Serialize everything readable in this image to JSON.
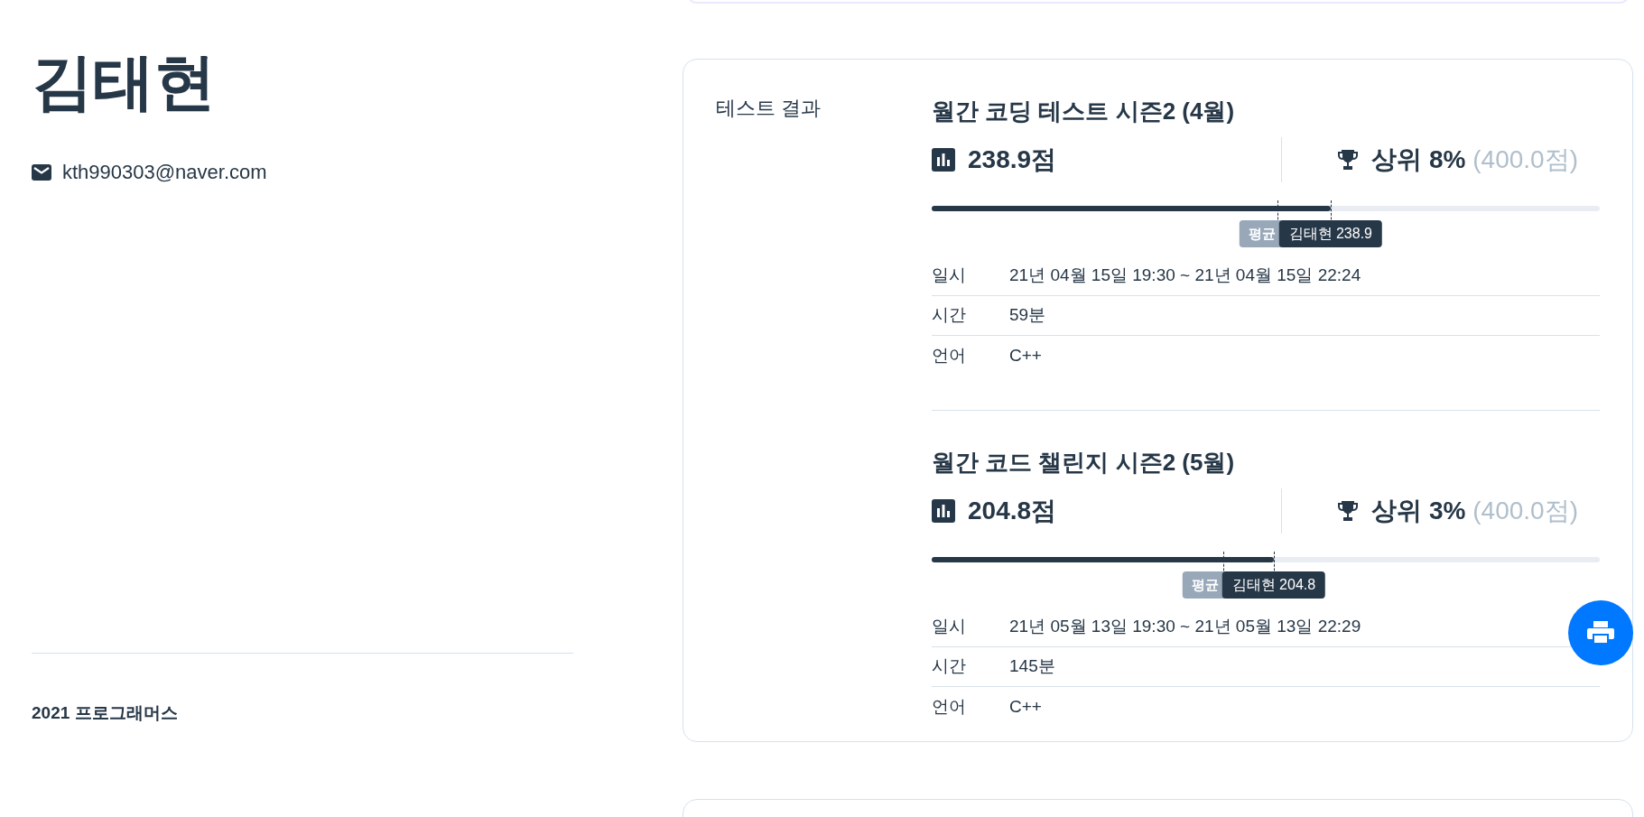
{
  "profile": {
    "name": "김태현",
    "email": "kth990303@naver.com"
  },
  "footer": {
    "copyright": "2021 프로그래머스"
  },
  "test_results": {
    "heading": "테스트 결과",
    "tests": [
      {
        "title": "월간 코딩 테스트 시즌2 (4월)",
        "score": "238.9점",
        "rank": "상위 8%",
        "max_score": "(400.0점)",
        "level": 0.597,
        "average": {
          "label": "평균",
          "level": 0.518
        },
        "user_marker": {
          "label": "김태현 238.9"
        },
        "details": [
          {
            "label": "일시",
            "value": "21년 04월 15일 19:30 ~ 21년 04월 15일 22:24"
          },
          {
            "label": "시간",
            "value": "59분"
          },
          {
            "label": "언어",
            "value": "C++"
          }
        ]
      },
      {
        "title": "월간 코드 챌린지 시즌2 (5월)",
        "score": "204.8점",
        "rank": "상위 3%",
        "max_score": "(400.0점)",
        "level": 0.512,
        "average": {
          "label": "평균",
          "level": 0.437
        },
        "user_marker": {
          "label": "김태현 204.8"
        },
        "details": [
          {
            "label": "일시",
            "value": "21년 05월 13일 19:30 ~ 21년 05월 13일 22:29"
          },
          {
            "label": "시간",
            "value": "145분"
          },
          {
            "label": "언어",
            "value": "C++"
          }
        ]
      }
    ]
  }
}
